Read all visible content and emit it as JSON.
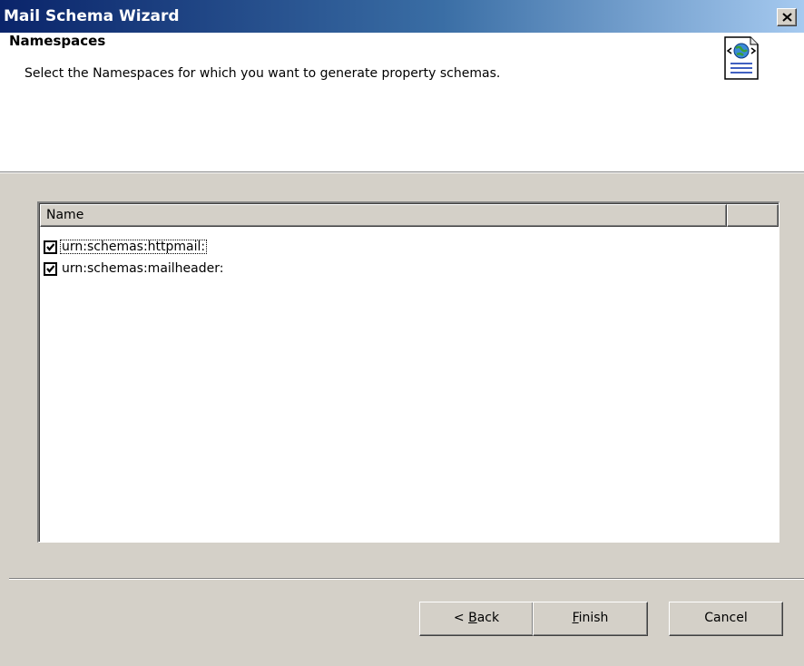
{
  "window": {
    "title": "Mail Schema Wizard",
    "close_label": "×"
  },
  "header": {
    "title": "Namespaces",
    "subtitle": "Select the Namespaces for which you want to generate property schemas.",
    "icon": "web-document-icon"
  },
  "list": {
    "columns": [
      "Name",
      ""
    ],
    "items": [
      {
        "label": "urn:schemas:httpmail:",
        "checked": true,
        "focused": true
      },
      {
        "label": "urn:schemas:mailheader:",
        "checked": true,
        "focused": false
      }
    ]
  },
  "buttons": {
    "back": {
      "prefix": "< ",
      "accel": "B",
      "rest": "ack"
    },
    "finish": {
      "prefix": "",
      "accel": "F",
      "rest": "inish"
    },
    "cancel": {
      "label": "Cancel"
    }
  },
  "colors": {
    "title_gradient_start": "#0a246a",
    "title_gradient_end": "#a6caf0",
    "face": "#d4d0c8"
  }
}
